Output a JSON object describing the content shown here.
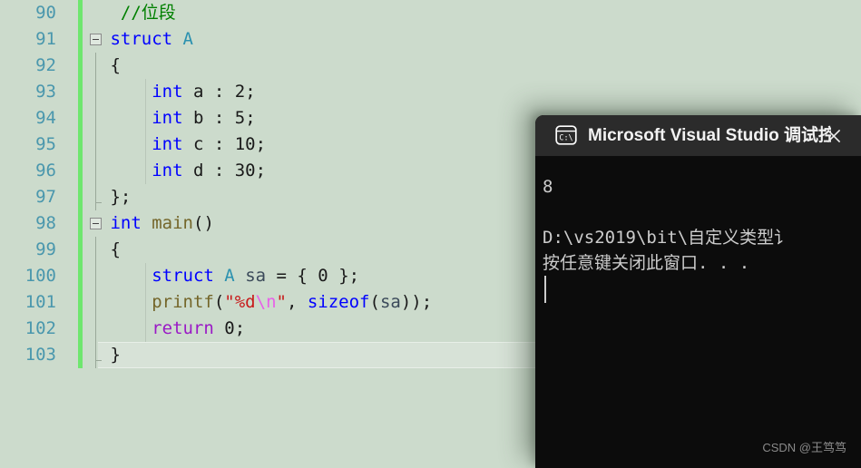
{
  "editor": {
    "name": "visual-studio-code-editor",
    "background_color": "#ccdbcc",
    "line_number_color": "#4a97ad",
    "change_bar_color": "#6ee66e",
    "current_line": 103,
    "lines": [
      {
        "number": "90",
        "text": "  //位段",
        "tokens": [
          {
            "t": "  ",
            "c": "plain"
          },
          {
            "t": "//位段",
            "c": "comment"
          }
        ]
      },
      {
        "number": "91",
        "text": " struct A",
        "tokens": [
          {
            "t": " ",
            "c": "plain"
          },
          {
            "t": "struct",
            "c": "keyword"
          },
          {
            "t": " ",
            "c": "plain"
          },
          {
            "t": "A",
            "c": "type"
          }
        ]
      },
      {
        "number": "92",
        "text": " {",
        "tokens": [
          {
            "t": " {",
            "c": "plain"
          }
        ]
      },
      {
        "number": "93",
        "text": "     int a : 2;",
        "tokens": [
          {
            "t": "     ",
            "c": "plain"
          },
          {
            "t": "int",
            "c": "keyword"
          },
          {
            "t": " a : ",
            "c": "plain"
          },
          {
            "t": "2",
            "c": "num"
          },
          {
            "t": ";",
            "c": "plain"
          }
        ]
      },
      {
        "number": "94",
        "text": "     int b : 5;",
        "tokens": [
          {
            "t": "     ",
            "c": "plain"
          },
          {
            "t": "int",
            "c": "keyword"
          },
          {
            "t": " b : ",
            "c": "plain"
          },
          {
            "t": "5",
            "c": "num"
          },
          {
            "t": ";",
            "c": "plain"
          }
        ]
      },
      {
        "number": "95",
        "text": "     int c : 10;",
        "tokens": [
          {
            "t": "     ",
            "c": "plain"
          },
          {
            "t": "int",
            "c": "keyword"
          },
          {
            "t": " c : ",
            "c": "plain"
          },
          {
            "t": "10",
            "c": "num"
          },
          {
            "t": ";",
            "c": "plain"
          }
        ]
      },
      {
        "number": "96",
        "text": "     int d : 30;",
        "tokens": [
          {
            "t": "     ",
            "c": "plain"
          },
          {
            "t": "int",
            "c": "keyword"
          },
          {
            "t": " d : ",
            "c": "plain"
          },
          {
            "t": "30",
            "c": "num"
          },
          {
            "t": ";",
            "c": "plain"
          }
        ]
      },
      {
        "number": "97",
        "text": " };",
        "tokens": [
          {
            "t": " };",
            "c": "plain"
          }
        ]
      },
      {
        "number": "98",
        "text": " int main()",
        "tokens": [
          {
            "t": " ",
            "c": "plain"
          },
          {
            "t": "int",
            "c": "keyword"
          },
          {
            "t": " ",
            "c": "plain"
          },
          {
            "t": "main",
            "c": "func"
          },
          {
            "t": "()",
            "c": "plain"
          }
        ]
      },
      {
        "number": "99",
        "text": " {",
        "tokens": [
          {
            "t": " {",
            "c": "plain"
          }
        ]
      },
      {
        "number": "100",
        "text": "     struct A sa = { 0 };",
        "tokens": [
          {
            "t": "     ",
            "c": "plain"
          },
          {
            "t": "struct",
            "c": "keyword"
          },
          {
            "t": " ",
            "c": "plain"
          },
          {
            "t": "A",
            "c": "type"
          },
          {
            "t": " ",
            "c": "plain"
          },
          {
            "t": "sa",
            "c": "ident"
          },
          {
            "t": " = { ",
            "c": "plain"
          },
          {
            "t": "0",
            "c": "num"
          },
          {
            "t": " };",
            "c": "plain"
          }
        ]
      },
      {
        "number": "101",
        "text": "     printf(\"%d\\n\", sizeof(sa));",
        "tokens": [
          {
            "t": "     ",
            "c": "plain"
          },
          {
            "t": "printf",
            "c": "func"
          },
          {
            "t": "(",
            "c": "plain"
          },
          {
            "t": "\"%d",
            "c": "string"
          },
          {
            "t": "\\n",
            "c": "escape"
          },
          {
            "t": "\"",
            "c": "string"
          },
          {
            "t": ", ",
            "c": "plain"
          },
          {
            "t": "sizeof",
            "c": "keyword"
          },
          {
            "t": "(",
            "c": "plain"
          },
          {
            "t": "sa",
            "c": "ident"
          },
          {
            "t": "));",
            "c": "plain"
          }
        ]
      },
      {
        "number": "102",
        "text": "     return 0;",
        "tokens": [
          {
            "t": "     ",
            "c": "plain"
          },
          {
            "t": "return",
            "c": "ctrl"
          },
          {
            "t": " ",
            "c": "plain"
          },
          {
            "t": "0",
            "c": "num"
          },
          {
            "t": ";",
            "c": "plain"
          }
        ]
      },
      {
        "number": "103",
        "text": " }",
        "tokens": [
          {
            "t": " }",
            "c": "plain"
          }
        ]
      }
    ]
  },
  "console_window": {
    "icon_name": "command-prompt-icon",
    "icon_label": "C:\\",
    "title": "Microsoft Visual Studio 调试控",
    "close_label": "✕",
    "output_lines": [
      "8",
      "",
      "D:\\vs2019\\bit\\自定义类型讠",
      "按任意键关闭此窗口. . ."
    ],
    "background_color": "#0c0c0c",
    "titlebar_color": "#2b2b2b",
    "text_color": "#cccccc"
  },
  "watermark": {
    "text": "CSDN @王笃笃"
  }
}
